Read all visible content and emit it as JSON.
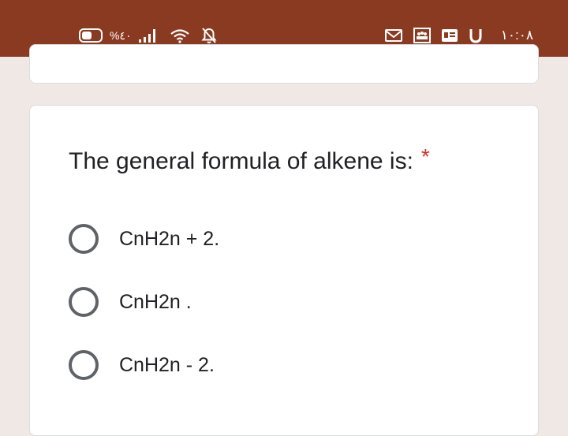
{
  "status_bar": {
    "battery_percent": "%٤٠",
    "time": "١٠:٠٨",
    "icons": {
      "signal": "signal-icon",
      "wifi": "wifi-icon",
      "notifications_off": "bell-off-icon",
      "gmail": "gmail-icon",
      "meeting": "meeting-icon",
      "news": "news-icon",
      "u_app": "u-app-icon"
    },
    "colors": {
      "background": "#8b3a22",
      "foreground": "#ffffff"
    }
  },
  "question": {
    "title": "The general formula of alkene is:",
    "required_mark": "*",
    "options": [
      {
        "label": "CnH2n + 2."
      },
      {
        "label": "CnH2n ."
      },
      {
        "label": "CnH2n - 2."
      }
    ]
  },
  "colors": {
    "page_background": "#f0e8e5",
    "required": "#d93025",
    "radio_border": "#5f6368"
  }
}
